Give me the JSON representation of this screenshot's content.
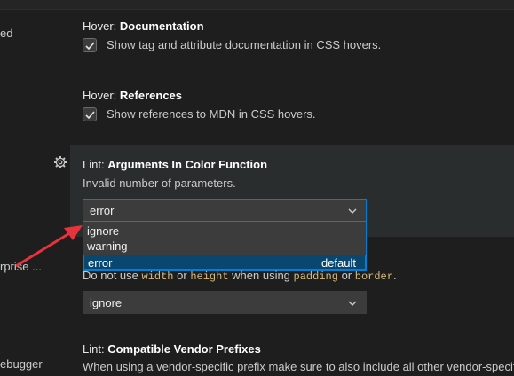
{
  "sidebar": {
    "items": [
      {
        "label": "ed"
      },
      {
        "label": "rprise ..."
      },
      {
        "label": "ebugger"
      }
    ]
  },
  "settings": {
    "hover_documentation": {
      "prefix": "Hover: ",
      "name": "Documentation",
      "description": "Show tag and attribute documentation in CSS hovers.",
      "checked": true
    },
    "hover_references": {
      "prefix": "Hover: ",
      "name": "References",
      "description": "Show references to MDN in CSS hovers.",
      "checked": true
    },
    "lint_args_color": {
      "prefix": "Lint: ",
      "name": "Arguments In Color Function",
      "description": "Invalid number of parameters.",
      "value": "error",
      "options": [
        {
          "label": "ignore",
          "badge": ""
        },
        {
          "label": "warning",
          "badge": ""
        },
        {
          "label": "error",
          "badge": "default"
        }
      ],
      "selected_index": 2
    },
    "lint_box_model": {
      "desc_parts": {
        "p1": "Do not use ",
        "c1": "width",
        "p2": " or ",
        "c2": "height",
        "p3": " when using ",
        "c3": "padding",
        "p4": " or ",
        "c4": "border",
        "p5": "."
      },
      "value": "ignore"
    },
    "lint_vendor_prefixes": {
      "prefix": "Lint: ",
      "name": "Compatible Vendor Prefixes",
      "description": "When using a vendor-specific prefix make sure to also include all other vendor-specific"
    }
  },
  "colors": {
    "accent": "#007fd4",
    "selection": "#094771",
    "annotation_arrow": "#e8323c"
  },
  "icons": {
    "gear": "gear-icon",
    "check": "check-icon",
    "chevron": "chevron-down-icon"
  }
}
